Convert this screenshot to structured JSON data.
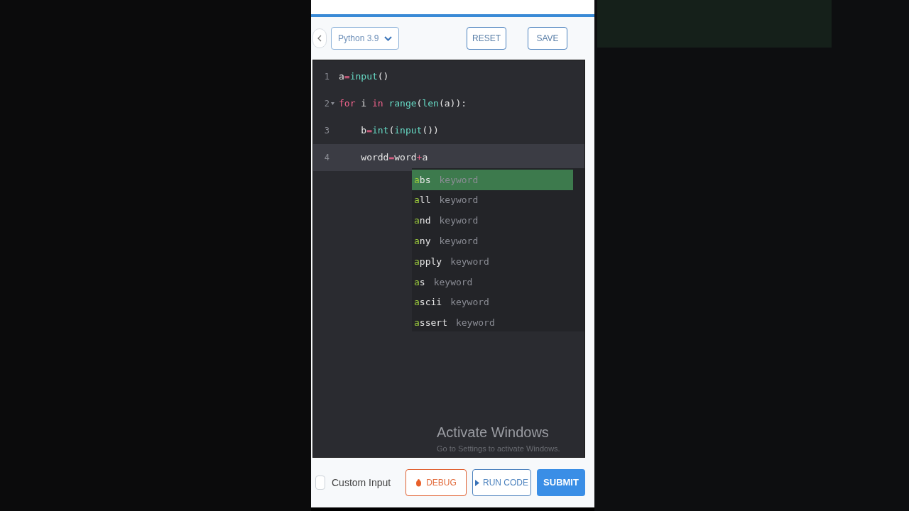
{
  "toolbar": {
    "language": "Python 3.9",
    "buttons": [
      {
        "label": "RESET"
      },
      {
        "label": "SAVE"
      }
    ]
  },
  "editor": {
    "lines": [
      {
        "number": "1",
        "foldable": false,
        "active": false,
        "tokens": [
          {
            "kind": "var",
            "text": "a"
          },
          {
            "kind": "op",
            "text": "="
          },
          {
            "kind": "func",
            "text": "input"
          },
          {
            "kind": "paren",
            "text": "()"
          }
        ]
      },
      {
        "number": "2",
        "foldable": true,
        "active": false,
        "tokens": [
          {
            "kind": "keyword",
            "text": "for"
          },
          {
            "kind": "var",
            "text": " i "
          },
          {
            "kind": "keyword",
            "text": "in"
          },
          {
            "kind": "func",
            "text": " range"
          },
          {
            "kind": "paren",
            "text": "("
          },
          {
            "kind": "func",
            "text": "len"
          },
          {
            "kind": "paren",
            "text": "(a)):"
          }
        ]
      },
      {
        "number": "3",
        "foldable": false,
        "active": false,
        "tokens": [
          {
            "kind": "var",
            "text": "    b"
          },
          {
            "kind": "op",
            "text": "="
          },
          {
            "kind": "func",
            "text": "int"
          },
          {
            "kind": "paren",
            "text": "("
          },
          {
            "kind": "func",
            "text": "input"
          },
          {
            "kind": "paren",
            "text": "())"
          }
        ]
      },
      {
        "number": "4",
        "foldable": false,
        "active": true,
        "tokens": [
          {
            "kind": "var",
            "text": "    wordd"
          },
          {
            "kind": "op",
            "text": "="
          },
          {
            "kind": "var",
            "text": "word"
          },
          {
            "kind": "op",
            "text": "+"
          },
          {
            "kind": "var",
            "text": "a"
          }
        ]
      }
    ],
    "suggestions": [
      {
        "match": "a",
        "rest": "bs",
        "type": "keyword",
        "selected": true
      },
      {
        "match": "a",
        "rest": "ll",
        "type": "keyword",
        "selected": false
      },
      {
        "match": "a",
        "rest": "nd",
        "type": "keyword",
        "selected": false
      },
      {
        "match": "a",
        "rest": "ny",
        "type": "keyword",
        "selected": false
      },
      {
        "match": "a",
        "rest": "pply",
        "type": "keyword",
        "selected": false
      },
      {
        "match": "a",
        "rest": "s",
        "type": "keyword",
        "selected": false
      },
      {
        "match": "a",
        "rest": "scii",
        "type": "keyword",
        "selected": false
      },
      {
        "match": "a",
        "rest": "ssert",
        "type": "keyword",
        "selected": false
      }
    ]
  },
  "os_notice": {
    "title": "Activate Windows",
    "subtitle": "Go to Settings to activate Windows."
  },
  "footer": {
    "custom_input": {
      "label": "Custom Input",
      "checked": false
    },
    "debug": "DEBUG",
    "run": "RUN CODE",
    "submit": "SUBMIT"
  }
}
